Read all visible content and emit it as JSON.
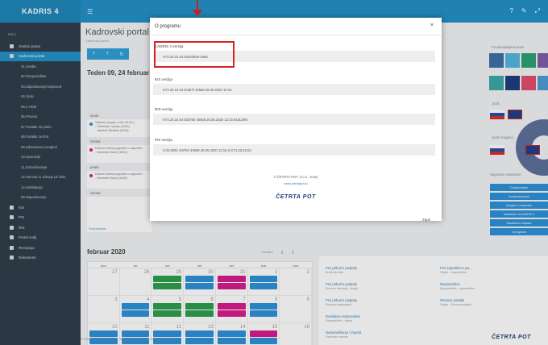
{
  "app": {
    "logo": "KADRIS 4",
    "page_title": "Kadrovski portal",
    "page_subtitle": "Kadrovski portal",
    "week_title": "Teden 09, 24 februar",
    "calendar_title": "februar 2020",
    "calendar_nav_label": "Trenutni",
    "agenda_link": "Podrobnosti",
    "footer": "© 2019 - Četrta pot, d.o.o., Kranj | KT4.20.22.04.20200526-1955",
    "footer_logo": "ČETRTA POT"
  },
  "sidebar": {
    "header": "Meni",
    "items": [
      {
        "label": "Osebni portal",
        "active": false
      },
      {
        "label": "Kadrovski portal",
        "active": true
      }
    ],
    "subitems": [
      "01.Osebe",
      "02.Razporeditve",
      "03.Zaposlovanje/Odpoved",
      "04.Izpisi",
      "05.e-VEM",
      "06.Prevozi",
      "07.Podatki za plačo",
      "08.Podatki za RIS",
      "09.Zdravstveni pregledi",
      "10.Operacije",
      "11.Izobraževanje",
      "12.Varnost in zdravje pri delu",
      "14.Habilitacije",
      "99.Zaposlovanje"
    ],
    "modules": [
      "KIS",
      "PIS",
      "RIS",
      "Portal vodij",
      "Recepcija",
      "Dokumenti"
    ]
  },
  "agenda": [
    {
      "day": "sreda",
      "events": [
        "Veščine (kopija z dne 19.02.)",
        "- Čebelarji: Ivanka (1000)",
        "- Jakobič Mihaela (1000)"
      ],
      "color": "#2a8fd8"
    },
    {
      "day": "četrtek",
      "events": [
        "Datumi izteka pogodbe o zaposlitvi",
        "- Deželnik Stane (1000)"
      ],
      "color": "#d6198a"
    },
    {
      "day": "petek",
      "events": [
        "Datumi izteka pogodbe o zaposlitvi",
        "- Deželnik Stane (1000)"
      ],
      "color": "#d6198a"
    },
    {
      "day": "sobota",
      "events": [],
      "color": "#ffffff"
    }
  ],
  "calendar": {
    "headers": [
      "pon.",
      "tor.",
      "sre.",
      "čet.",
      "pet.",
      "sob.",
      "ned."
    ],
    "rows": [
      [
        {
          "n": "27",
          "ev": []
        },
        {
          "n": "28",
          "ev": []
        },
        {
          "n": "29",
          "ev": [
            "#2a9d4a",
            "#2a9d4a"
          ]
        },
        {
          "n": "30",
          "ev": [
            "#2a8fd8",
            "#2a8fd8"
          ]
        },
        {
          "n": "31",
          "ev": [
            "#d6198a",
            "#d6198a"
          ]
        },
        {
          "n": "1",
          "ev": [
            "#2a8fd8",
            "#2a8fd8"
          ]
        },
        {
          "n": "2",
          "ev": []
        }
      ],
      [
        {
          "n": "3",
          "ev": []
        },
        {
          "n": "4",
          "ev": [
            "#2a8fd8",
            "#2a8fd8"
          ]
        },
        {
          "n": "5",
          "ev": [
            "#2a9d4a",
            "#2a9d4a"
          ]
        },
        {
          "n": "6",
          "ev": [
            "#2a9d4a",
            "#2a9d4a"
          ]
        },
        {
          "n": "7",
          "ev": [
            "#d6198a",
            "#d6198a"
          ]
        },
        {
          "n": "8",
          "ev": [
            "#2a8fd8",
            "#2a8fd8"
          ]
        },
        {
          "n": "9",
          "ev": []
        }
      ],
      [
        {
          "n": "10",
          "ev": [
            "#2a8fd8",
            "#2a8fd8"
          ]
        },
        {
          "n": "11",
          "ev": [
            "#2a8fd8",
            "#2a8fd8"
          ]
        },
        {
          "n": "12",
          "ev": [
            "#2a8fd8",
            "#2a8fd8"
          ]
        },
        {
          "n": "13",
          "ev": [
            "#2a8fd8",
            "#2a8fd8"
          ]
        },
        {
          "n": "14",
          "ev": [
            "#2a8fd8",
            "#2a8fd8"
          ]
        },
        {
          "n": "15",
          "ev": [
            "#d6198a",
            "#2a8fd8"
          ]
        },
        {
          "n": "16",
          "ev": []
        }
      ]
    ]
  },
  "info_items": [
    {
      "title": "Prvi prihod s podjetje",
      "sub": "Družinski član"
    },
    {
      "title": "Prvi prihod s podjetje",
      "sub": "Delovno razmerje - stanje"
    },
    {
      "title": "Prvi prihod s podjetje",
      "sub": "Pristopni razporejeni"
    },
    {
      "title": "Dodeljene razporeditve",
      "sub": "Razporeditve - stanje"
    },
    {
      "title": "Nadomeščanje / Zaposl.",
      "sub": "Vsebinski seznam"
    },
    {
      "title": "Prvi zaposlitev s po...",
      "sub": "Osebe - razporeditve"
    },
    {
      "title": "Razporeditve",
      "sub": "Razporeditve - razporeditve"
    },
    {
      "title": "Osnovni podatki",
      "sub": "Osebe - Osnovni podatki"
    }
  ],
  "right_panel": {
    "theme_label": "Prednastavljene teme",
    "lang_label": "Jezik",
    "lang_label2": "Jezik izvajalca",
    "quick_label": "Napredne nastavitve",
    "buttons": [
      "Dodaj kontakt",
      "Dodaj dokument",
      "Vpogled v nastavitve",
      "Nastavitve za KADRIS 4",
      "Nastavitve izvajalca",
      "O programu"
    ]
  },
  "theme_colors": [
    "#3a6ea5",
    "#4fb4e0",
    "#2aa070",
    "#7a5aa8",
    "#3aa7a7",
    "#1a3a7a",
    "#e24a6a",
    "#4b9ad6"
  ],
  "modal": {
    "title": "O programu",
    "close_symbol": "×",
    "blocks": [
      {
        "label": "KADRIS 4 verzija",
        "value": "KT4.20.22.04.20200526-1955"
      },
      {
        "label": "KIS verzija",
        "value": "KT4.20.22.04 5c567f 40558 26.05.2020 12:15"
      },
      {
        "label": "RIS verzija",
        "value": "KT4.20.22.04 82b7b0 40558 26.05.2020 12:15 BUILDR4"
      },
      {
        "label": "PIS verzija",
        "value": "3.00.0094 r19794 40558 26.05.2020 12:15 (r KT4.20.22.04"
      }
    ],
    "company": "© ČETRTA POT, d.o.o., Kranj",
    "company_link": "www.cetrtapot.si",
    "company_logo": "ČETRTA POT",
    "zapri": "Zapri"
  }
}
